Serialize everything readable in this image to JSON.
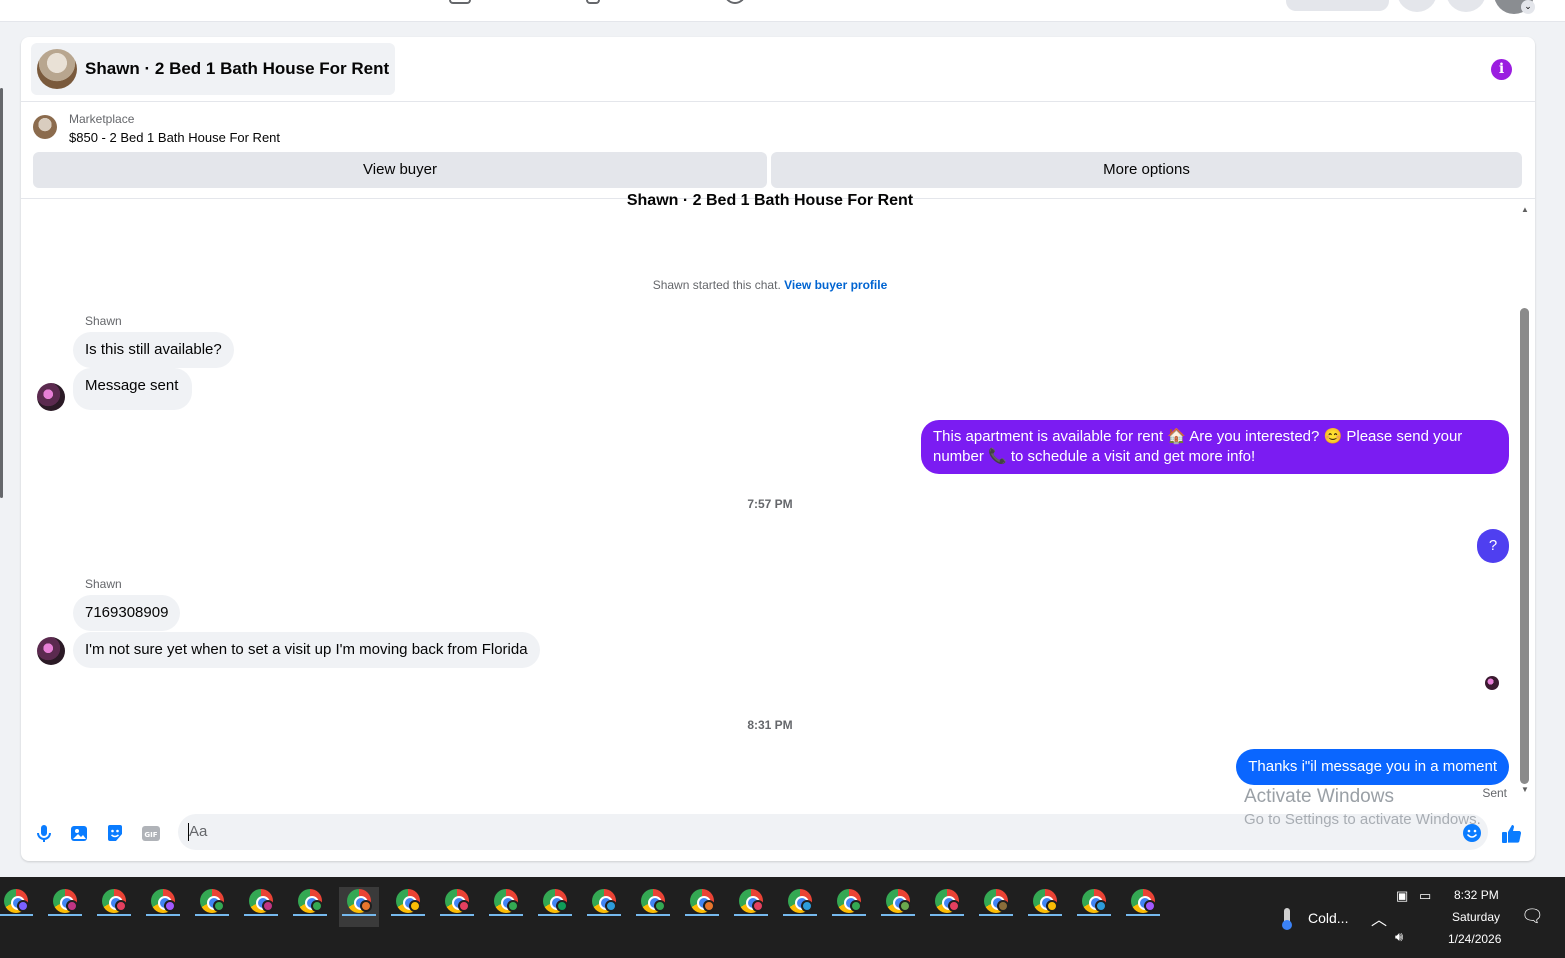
{
  "header": {
    "title": "Shawn · 2 Bed 1 Bath House For Rent"
  },
  "marketplace": {
    "label": "Marketplace",
    "listing": "$850 - 2 Bed 1 Bath House For Rent",
    "view_buyer": "View buyer",
    "more_options": "More options"
  },
  "conversation": {
    "listing_title": "Shawn · 2 Bed 1 Bath House For Rent",
    "started_text": "Shawn started this chat.",
    "view_profile_link": "View buyer profile",
    "messages": [
      {
        "sender": "Shawn",
        "text": "Is this still available?"
      },
      {
        "text": "Message sent"
      },
      {
        "text": "This apartment is available for rent 🏠 Are you interested? 😊 Please send your number 📞 to schedule a visit and get more info!"
      },
      {
        "text": "?"
      },
      {
        "sender": "Shawn",
        "text": "7169308909"
      },
      {
        "text": "I'm not sure yet when to set a visit up I'm moving back from Florida"
      },
      {
        "text": "Thanks i\"il message you in a moment"
      }
    ],
    "timestamps": [
      "7:57 PM",
      "8:31 PM"
    ],
    "status": "Sent"
  },
  "composer": {
    "placeholder": "Aa"
  },
  "watermark": {
    "line1": "Activate Windows",
    "line2": "Go to Settings to activate Windows."
  },
  "taskbar": {
    "weather": "Cold...",
    "time": "8:32 PM",
    "day": "Saturday",
    "date": "1/24/2026",
    "app_badges": [
      "#7b61ff",
      "#c13584",
      "#e4405f",
      "#a259ff",
      "#34a853",
      "#c13584",
      "#34a853",
      "#e8762d",
      "#fbbc05",
      "#e4405f",
      "#34a853",
      "#0f9d58",
      "#2d9cdb",
      "#34a853",
      "#e8762d",
      "#e4405f",
      "#2d9cdb",
      "#34a853",
      "#6aa84f",
      "#e4405f",
      "#8a6d3b",
      "#fbbc05",
      "#2d9cdb",
      "#a259ff"
    ]
  },
  "colors": {
    "accent_purple": "#9b1de0",
    "bubble_purple": "#7b1cf2",
    "bubble_indigo": "#4f3ff0",
    "bubble_blue": "#0a66ff",
    "messenger_blue": "#0a7cff"
  }
}
